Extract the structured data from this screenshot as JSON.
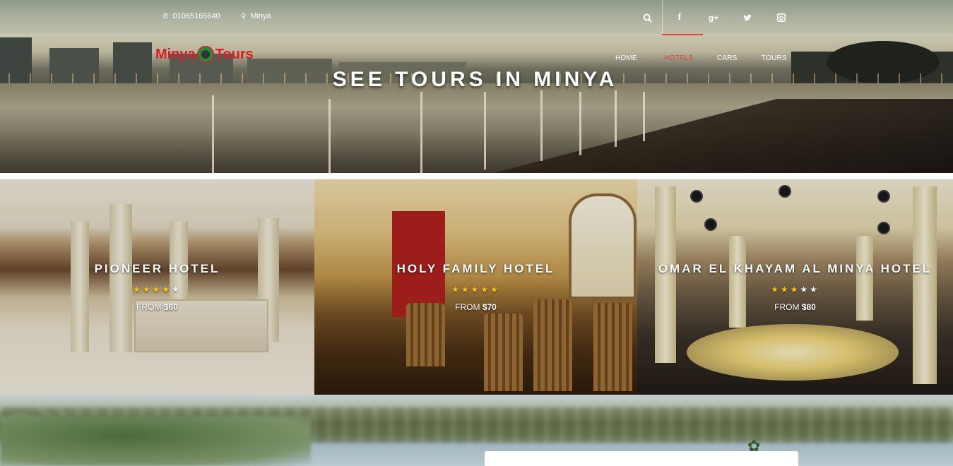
{
  "header": {
    "phone": "01065165640",
    "location": "Minya",
    "logo": {
      "part1": "Minya",
      "part2": "Tours"
    },
    "nav": [
      "HOME",
      "HOTELS",
      "CARS",
      "TOURS"
    ],
    "active_nav": "HOTELS",
    "social": {
      "facebook": "f",
      "google_plus": "g+",
      "twitter": "t",
      "instagram": "ig"
    },
    "icons": {
      "search": "search-icon",
      "phone": "phone-icon",
      "location": "map-marker-icon"
    },
    "accent_color": "#e0403a"
  },
  "hero": {
    "title": "SEE TOURS IN MINYA"
  },
  "hotels": [
    {
      "name": "PIONEER HOTEL",
      "rating": 4,
      "max_rating": 5,
      "price_prefix": "FROM",
      "price": "$60"
    },
    {
      "name": "HOLY FAMILY HOTEL",
      "rating": 5,
      "max_rating": 5,
      "price_prefix": "FROM",
      "price": "$70"
    },
    {
      "name": "OMAR EL KHAYAM AL MINYA HOTEL",
      "rating": 3,
      "max_rating": 5,
      "price_prefix": "FROM",
      "price": "$80"
    }
  ]
}
